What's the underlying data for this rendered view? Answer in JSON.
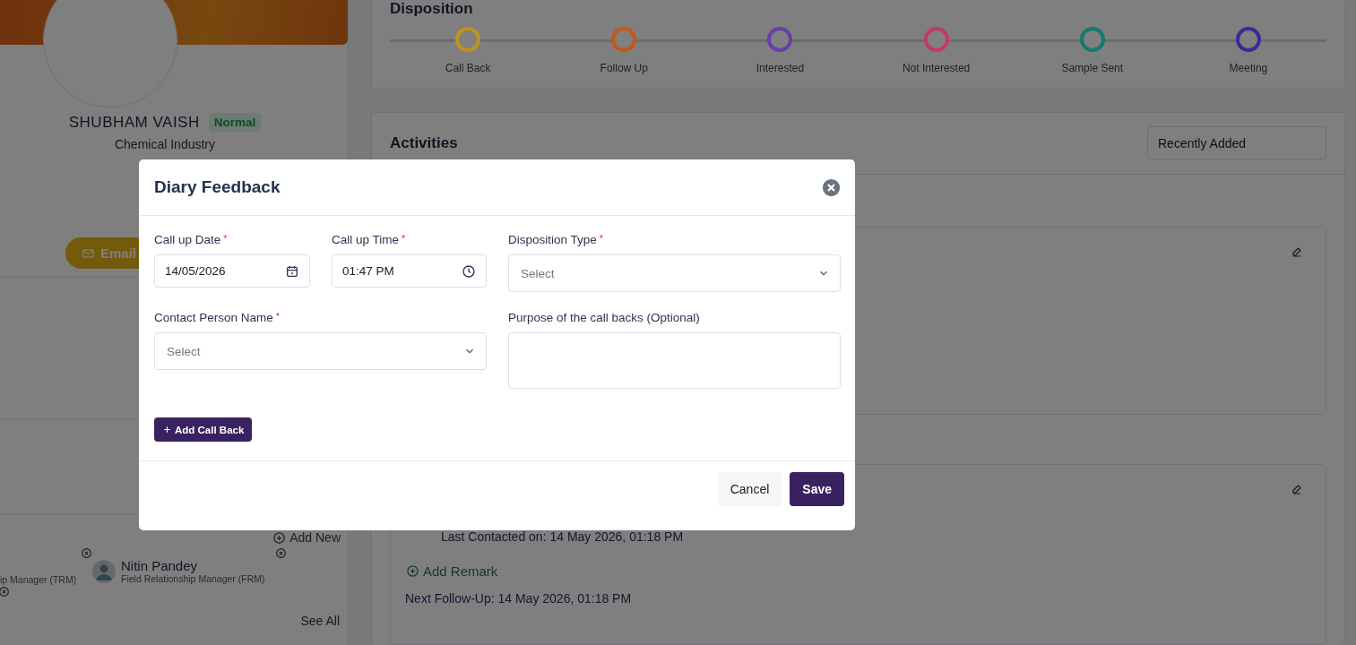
{
  "profile": {
    "name": "SHUBHAM VAISH",
    "badge": "Normal",
    "industry": "Chemical Industry",
    "email_button": "Email"
  },
  "team": {
    "add_new": "Add New",
    "members": [
      {
        "role": "ip Manager (TRM)"
      },
      {
        "name": "Nitin Pandey",
        "role": "Field Relationship Manager (FRM)"
      }
    ],
    "see_all": "See All"
  },
  "disposition": {
    "title": "Disposition",
    "stages": [
      {
        "label": "Call Back",
        "color": "#c0921e"
      },
      {
        "label": "Follow Up",
        "color": "#c2581a"
      },
      {
        "label": "Interested",
        "color": "#6a3ea8"
      },
      {
        "label": "Not Interested",
        "color": "#c23a6a"
      },
      {
        "label": "Sample Sent",
        "color": "#137a70"
      },
      {
        "label": "Meeting",
        "color": "#3a2a9a"
      }
    ]
  },
  "activities": {
    "title": "Activities",
    "sort": "Recently Added",
    "last_contacted": "Last Contacted on: 14 May 2026, 01:18 PM",
    "add_remark": "Add Remark",
    "next_follow_up": "Next Follow-Up: 14 May 2026, 01:18 PM"
  },
  "modal": {
    "title": "Diary Feedback",
    "fields": [
      {
        "kind": "date",
        "label": "Call up Date",
        "required_mark": "*",
        "value": "14/05/2026"
      },
      {
        "kind": "time",
        "label": "Call up Time",
        "required_mark": "*",
        "value": "01:47 PM"
      },
      {
        "kind": "select",
        "label": "Disposition Type",
        "required_mark": "*",
        "placeholder": "Select"
      },
      {
        "kind": "select",
        "label": "Contact Person Name",
        "required_mark": "*",
        "placeholder": "Select"
      },
      {
        "kind": "textarea",
        "label": "Purpose of the call backs (Optional)"
      }
    ],
    "add_button": "Add Call Back",
    "cancel": "Cancel",
    "save": "Save"
  }
}
